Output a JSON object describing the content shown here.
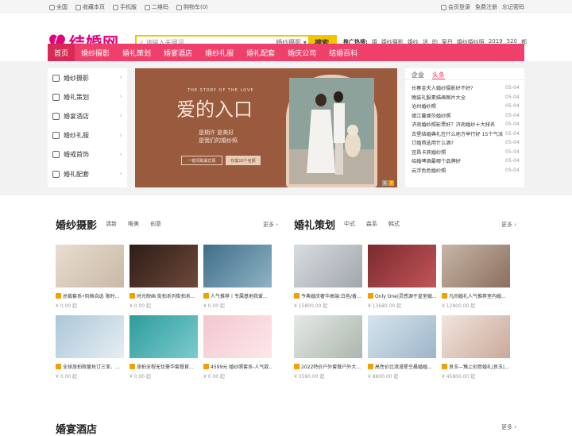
{
  "topbar": {
    "left": [
      "全国",
      "收藏本页",
      "手机版",
      "二维码",
      "购物车(0)"
    ],
    "right": [
      "会员登录",
      "免费注册",
      "忘记密码"
    ]
  },
  "logo": {
    "text": "结婚网"
  },
  "search": {
    "placeholder": "请输入关键词",
    "category": "婚纱摄影",
    "button": "搜索"
  },
  "hot": {
    "label": "推广热搜:",
    "terms": [
      "婚",
      "婚纱摄影",
      "婚纱",
      "送",
      "的",
      "案丹",
      "婚纱婚纱照",
      "2019",
      "520",
      "都"
    ]
  },
  "nav": [
    "首页",
    "婚纱摄影",
    "婚礼策划",
    "婚宴酒店",
    "婚纱礼服",
    "婚礼配套",
    "婚庆公司",
    "结婚百科"
  ],
  "categories": [
    "婚纱摄影",
    "婚礼策划",
    "婚宴酒店",
    "婚纱礼服",
    "婚戒首饰",
    "婚礼配套"
  ],
  "banner": {
    "subtitle": "THE STORY OF THE LOVE",
    "title": "爱的入口",
    "line1": "是期许 是美好",
    "line2": "是我们的婚纱照",
    "btn1": "一键领取最优惠",
    "btn2": "仅需10个名额",
    "dots": [
      "1",
      "2"
    ]
  },
  "news": {
    "tabs": [
      "企业",
      "头条"
    ],
    "items": [
      {
        "t": "长春金夫人婚纱摄影好不好?",
        "d": "05-04"
      },
      {
        "t": "晚装礼服素描画图片大全",
        "d": "05-04"
      },
      {
        "t": "沧州婚纱照",
        "d": "05-04"
      },
      {
        "t": "德江蔓娜莎婚纱照",
        "d": "05-04"
      },
      {
        "t": "济南婚纱照影票好？济南婚纱十大排名",
        "d": "05-04"
      },
      {
        "t": "古堡结婚典礼在什么地方举行好 15个气派",
        "d": "05-04"
      },
      {
        "t": "订婚首选用什么酒?",
        "d": "05-04"
      },
      {
        "t": "宜昌卡其婚纱照",
        "d": "05-04"
      },
      {
        "t": "绍婚啤酒最哪个品牌好",
        "d": "05-04"
      },
      {
        "t": "云浮色色婚纱照",
        "d": "05-04"
      }
    ]
  },
  "sec1": {
    "title": "婚纱摄影",
    "tags": [
      "清新",
      "唯美",
      "创意"
    ],
    "more": "更多 ›",
    "cards": [
      {
        "cap": "总裁套系•风格自选 限时...",
        "price": "¥ 0.00",
        "unit": "起"
      },
      {
        "cap": "时光映画 街拍系列街拍系...",
        "price": "¥ 0.00",
        "unit": "起"
      },
      {
        "cap": "人气推荐丨专属基地我爱...",
        "price": "¥ 0.00",
        "unit": "起"
      },
      {
        "cap": "全球旅拍限量抢订三亚、...",
        "price": "¥ 0.00",
        "unit": "起"
      },
      {
        "cap": "旅拍全程无忧豪华套餐首...",
        "price": "¥ 0.00",
        "unit": "起"
      },
      {
        "cap": "4599元 婚纱照套系-人气款...",
        "price": "¥ 0.00",
        "unit": "起"
      }
    ]
  },
  "sec2": {
    "title": "婚礼策划",
    "tags": [
      "中式",
      "森系",
      "韩式"
    ],
    "more": "更多 ›",
    "cards": [
      {
        "cap": "今典婚庆奢华高端:白色/香...",
        "price": "¥ 15800.00",
        "unit": "起"
      },
      {
        "cap": "Only One|灵感源于皇室婚...",
        "price": "¥ 13680.00",
        "unit": "起"
      },
      {
        "cap": "凡间婚礼人气推荐室内婚...",
        "price": "¥ 12800.00",
        "unit": "起"
      },
      {
        "cap": "2022特价户外套餐户外大...",
        "price": "¥ 3590.00",
        "unit": "起"
      },
      {
        "cap": "高性价比浪漫星空晨婚婚...",
        "price": "¥ 8800.00",
        "unit": "起"
      },
      {
        "cap": "良玉—豫上创意婚礼|良玉|...",
        "price": "¥ 45800.00",
        "unit": "起"
      }
    ]
  },
  "sec3": {
    "title": "婚宴酒店",
    "more": "更多 ›"
  },
  "colors": {
    "nav": "#ef3f6b",
    "accent": "#e6007e",
    "search": "#f5c400"
  }
}
